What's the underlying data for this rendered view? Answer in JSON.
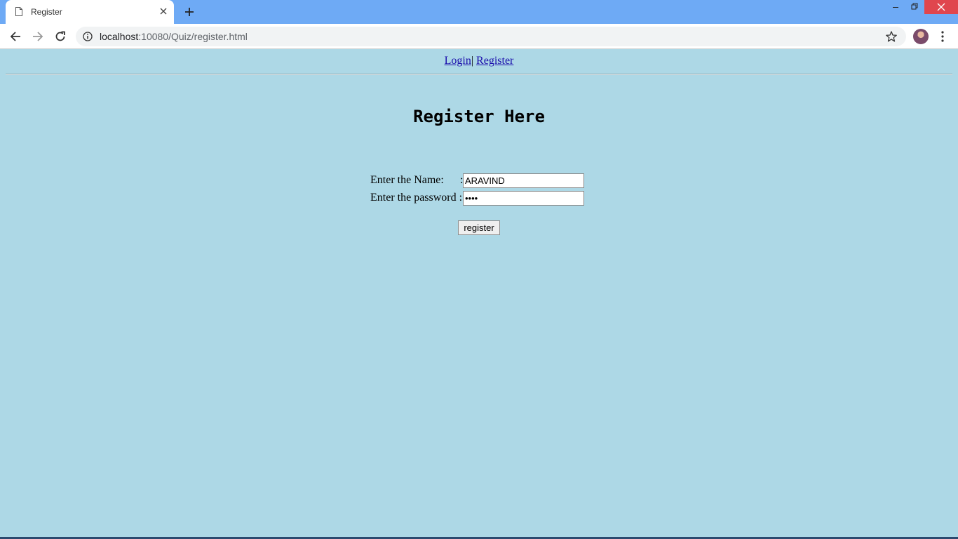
{
  "browser": {
    "tab_title": "Register",
    "url_host": "localhost",
    "url_path": ":10080/Quiz/register.html"
  },
  "nav": {
    "login": "Login",
    "separator": "|",
    "register": "Register"
  },
  "heading": "Register Here",
  "form": {
    "name_label": "Enter the Name:",
    "name_colon": ":",
    "name_value": "ARAVIND",
    "password_label": "Enter the password :",
    "password_value": "••••",
    "submit_label": "register"
  },
  "colors": {
    "page_bg": "#add8e6",
    "titlebar_bg": "#6eaaf5",
    "close_button": "#e0464e",
    "link": "#1a0dab"
  }
}
